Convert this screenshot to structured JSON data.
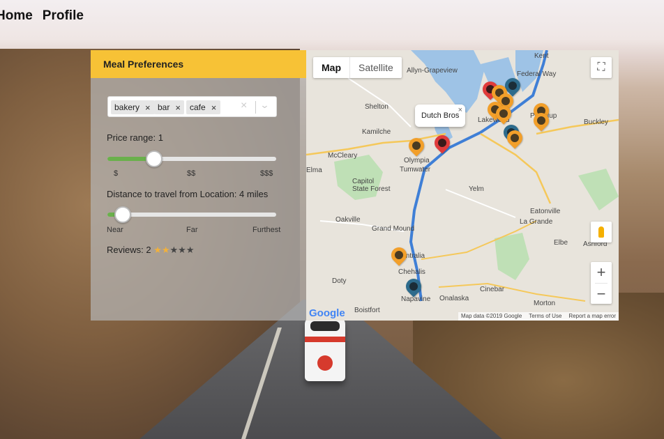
{
  "nav": {
    "home": "Home",
    "profile": "Profile"
  },
  "panel": {
    "title": "Meal Preferences",
    "chips": [
      "bakery",
      "bar",
      "cafe"
    ],
    "clear_icon": "×",
    "chevron_icon": "⌄",
    "price": {
      "label": "Price range: 1",
      "level": 1,
      "ticks": [
        "$",
        "$$",
        "$$$"
      ]
    },
    "distance": {
      "label": "Distance to travel from Location: 4 miles",
      "ticks": [
        "Near",
        "Far",
        "Furthest"
      ]
    },
    "reviews": {
      "label": "Reviews: 2",
      "filled": 2,
      "total": 5
    }
  },
  "map": {
    "tabs": [
      "Map",
      "Satellite"
    ],
    "info_window": "Dutch Bros",
    "places": {
      "kent": "Kent",
      "federal_way": "Federal Way",
      "allyn": "Allyn-Grapeview",
      "shelton": "Shelton",
      "kamilche": "Kamilche",
      "mccleary": "McCleary",
      "olympia": "Olympia",
      "tumwater": "Tumwater",
      "capitol": "Capitol\nState Forest",
      "lakewood": "Lakewood",
      "puyallup": "Puyallup",
      "buckley": "Buckley",
      "yelm": "Yelm",
      "oakville": "Oakville",
      "grand_mound": "Grand Mound",
      "eatonville": "Eatonville",
      "la_grande": "La Grande",
      "elbe": "Elbe",
      "ashford": "Ashford",
      "centralia": "Centralia",
      "chehalis": "Chehalis",
      "doty": "Doty",
      "napavine": "Napavine",
      "onalaska": "Onalaska",
      "cinebar": "Cinebar",
      "morton": "Morton",
      "boistfort": "Boistfort",
      "elma": "Elma"
    },
    "google_logo": "Google",
    "attribution": [
      "Map data ©2019 Google",
      "Terms of Use",
      "Report a map error"
    ]
  },
  "colors": {
    "header": "#f7c236",
    "slider_fill": "#6ab04c",
    "star_on": "#f2b13b"
  }
}
